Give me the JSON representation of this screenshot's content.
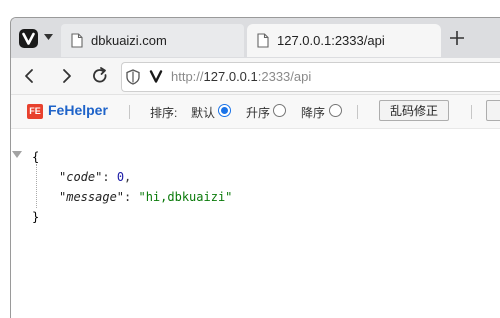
{
  "tabs": [
    {
      "title": "dbkuaizi.com",
      "active": false
    },
    {
      "title": "127.0.0.1:2333/api",
      "active": true
    }
  ],
  "address": {
    "scheme": "http://",
    "host": "127.0.0.1",
    "rest": ":2333/api"
  },
  "fehelper": {
    "name": "FeHelper",
    "logo_text": "FE",
    "sort_label": "排序:",
    "sort_options": [
      {
        "label": "默认",
        "selected": true
      },
      {
        "label": "升序",
        "selected": false
      },
      {
        "label": "降序",
        "selected": false
      }
    ],
    "fix_button": "乱码修正"
  },
  "json": {
    "open_brace": "{",
    "close_brace": "}",
    "entries": [
      {
        "key": "\"code\"",
        "value": "0",
        "type": "number"
      },
      {
        "key": "\"message\"",
        "value": "\"hi,dbkuaizi\"",
        "type": "string"
      }
    ]
  },
  "icons": [
    "vivaldi-logo-icon",
    "chevron-down-icon",
    "document-icon",
    "plus-icon",
    "back-icon",
    "forward-icon",
    "reload-icon",
    "shield-icon",
    "vivaldi-v-icon"
  ],
  "colors": {
    "accent": "#1a73e8",
    "fehelper_blue": "#1e63c9",
    "json_number": "#1a1aa6",
    "json_string": "#0a7a0a"
  }
}
